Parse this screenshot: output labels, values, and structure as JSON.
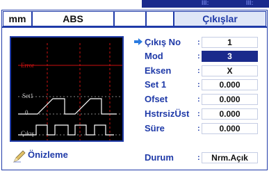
{
  "status": {
    "indicator_left": "III:",
    "indicator_right": "III:"
  },
  "tabs": [
    {
      "label": "mm"
    },
    {
      "label": "ABS"
    },
    {
      "label": ""
    },
    {
      "label": ""
    },
    {
      "label": "Çıkışlar"
    }
  ],
  "preview": {
    "label_error": "Error",
    "label_set1": "Set1",
    "label_zero": "0",
    "label_output": "Çıkış",
    "button_label": "Önizleme"
  },
  "params": [
    {
      "label": "Çıkış No",
      "value": "1"
    },
    {
      "label": "Mod",
      "value": "3",
      "selected": true
    },
    {
      "label": "Eksen",
      "value": "X"
    },
    {
      "label": "Set 1",
      "value": "0.000"
    },
    {
      "label": "Ofset",
      "value": "0.000"
    },
    {
      "label": "HstrsizÜst",
      "value": "0.000"
    },
    {
      "label": "Süre",
      "value": "0.000"
    },
    {
      "label": "Durum",
      "value": "Nrm.Açık"
    }
  ],
  "colors": {
    "accent": "#1f3aa8",
    "selected_bg": "#1a2a8c",
    "error_line": "#cc1111",
    "trace": "#ffffff"
  }
}
